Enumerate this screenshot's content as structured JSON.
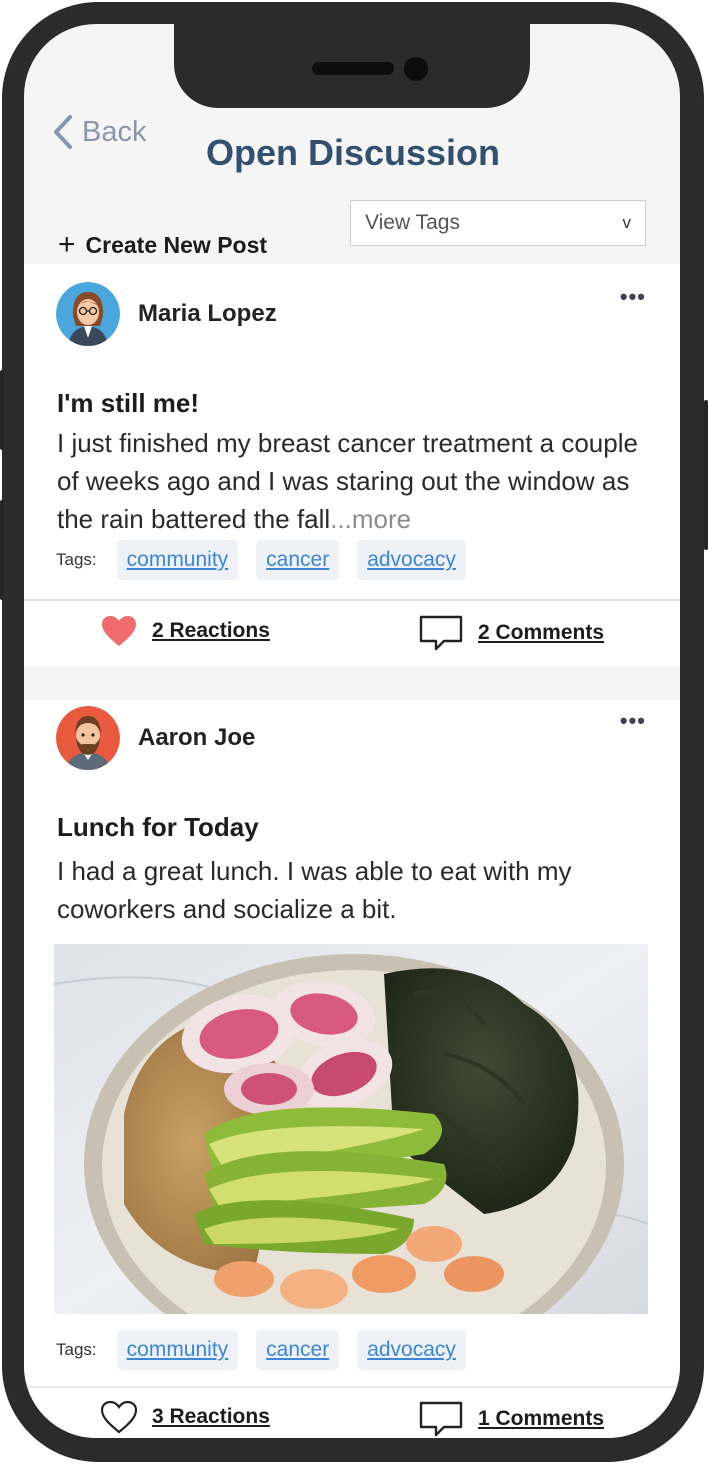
{
  "header": {
    "back_label": "Back",
    "title": "Open Discussion",
    "create_label": "Create New Post",
    "view_tags": {
      "selected": "View Tags",
      "chevron": "v"
    }
  },
  "posts": [
    {
      "author": "Maria Lopez",
      "title": "I'm still me!",
      "body": "I just finished my breast cancer treatment a couple of weeks ago and I was staring out the window as the rain battered the fall",
      "more": "...more",
      "tags_label": "Tags:",
      "tags": [
        "community",
        "cancer",
        "advocacy"
      ],
      "reactions": "2 Reactions",
      "reacted": true,
      "comments": "2 Comments",
      "menu": "•••"
    },
    {
      "author": "Aaron Joe",
      "title": "Lunch for Today",
      "body": "I had a great lunch. I was able to eat with my coworkers and socialize a bit.",
      "image_icon": "food-bowl-photo",
      "tags_label": "Tags:",
      "tags": [
        "community",
        "cancer",
        "advocacy"
      ],
      "reactions": "3 Reactions",
      "reacted": false,
      "comments": "1 Comments",
      "menu": "•••"
    }
  ],
  "colors": {
    "title": "#34506f",
    "link": "#3d86d6",
    "heart": "#f06b6b",
    "back": "#8a97ab"
  }
}
